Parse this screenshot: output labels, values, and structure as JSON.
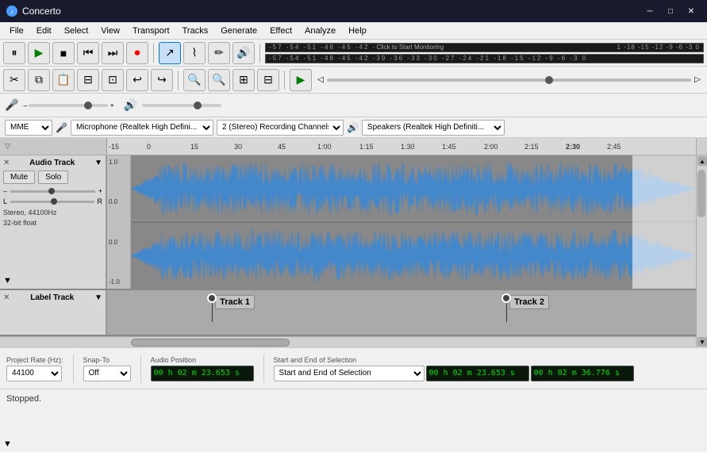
{
  "app": {
    "title": "Concerto",
    "icon": "♪"
  },
  "titlebar": {
    "minimize": "─",
    "maximize": "□",
    "close": "✕"
  },
  "menu": {
    "items": [
      "File",
      "Edit",
      "Select",
      "View",
      "Transport",
      "Tracks",
      "Generate",
      "Effect",
      "Analyze",
      "Help"
    ]
  },
  "toolbar": {
    "play": "▶",
    "pause": "⏸",
    "stop": "■",
    "prev": "⏮",
    "next": "⏭",
    "record": "⏺"
  },
  "devices": {
    "api": "MME",
    "microphone": "Microphone (Realtek High Defini...",
    "channels": "2 (Stereo) Recording Channels",
    "speaker": "Speakers (Realtek High Definiti..."
  },
  "tracks": {
    "audio": {
      "name": "Audio Track",
      "mute": "Mute",
      "solo": "Solo",
      "info": "Stereo, 44100Hz\n32-bit float"
    },
    "label": {
      "name": "Label Track",
      "markers": [
        {
          "label": "Track 1",
          "x_pct": 17
        },
        {
          "label": "Track 2",
          "x_pct": 67
        }
      ]
    }
  },
  "bottombar": {
    "project_rate_label": "Project Rate (Hz):",
    "project_rate_value": "44100",
    "snap_to_label": "Snap-To",
    "snap_to_value": "Off",
    "audio_pos_label": "Audio Position",
    "audio_pos_value": "0 0 h 0 2 m 2 3 . 6 5 3 s",
    "selection_label": "Start and End of Selection",
    "selection_start": "0 0 h 0 2 m 2 3 . 6 5 3 s",
    "selection_end": "0 0 h 0 2 m 3 6 . 7 7 6 s"
  },
  "status": {
    "text": "Stopped."
  },
  "timeline": {
    "ticks": [
      "-15",
      "0",
      "15",
      "30",
      "45",
      "1:00",
      "1:15",
      "1:30",
      "1:45",
      "2:00",
      "2:15",
      "2:30",
      "2:45"
    ]
  }
}
